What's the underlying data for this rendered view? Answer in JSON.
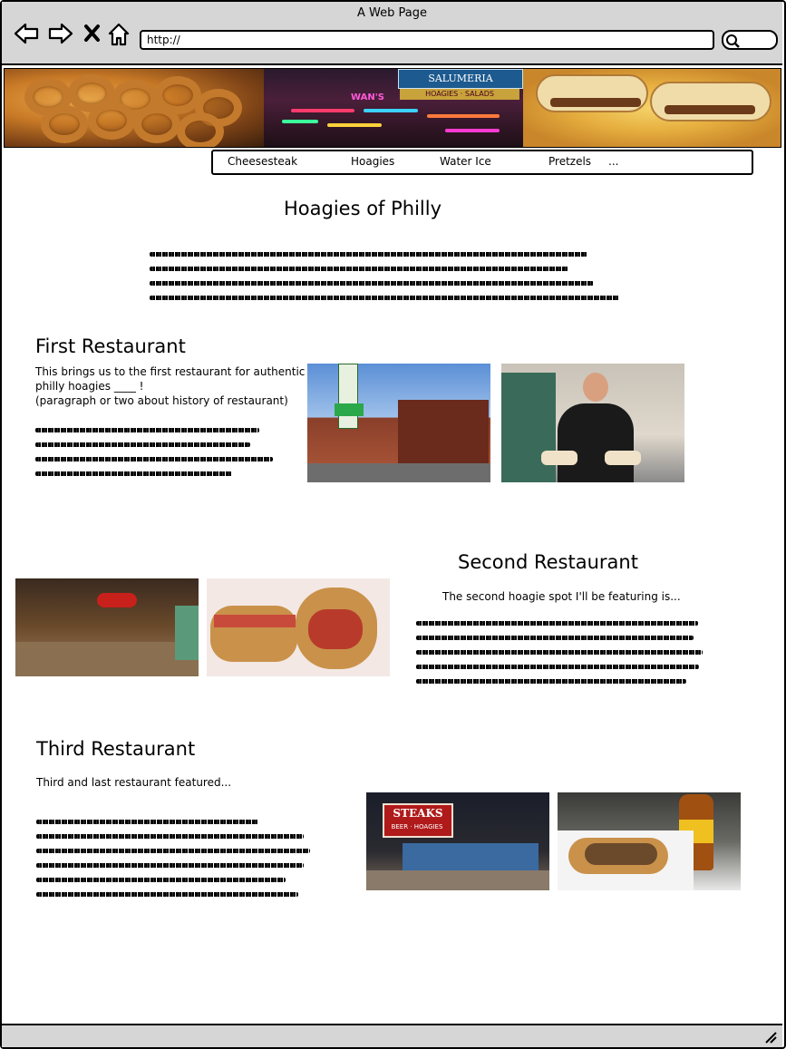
{
  "window": {
    "title": "A Web Page"
  },
  "browser": {
    "url": "http://"
  },
  "nav": {
    "items": [
      "Cheesesteak",
      "Hoagies",
      "Water Ice",
      "Pretzels",
      "..."
    ]
  },
  "page": {
    "title": "Hoagies of Philly"
  },
  "sections": [
    {
      "heading": "First Restaurant",
      "intro_line1": "This brings us to the first restaurant for authentic",
      "intro_line2": "philly hoagies ____ !",
      "intro_line3": "(paragraph or two about history of restaurant)"
    },
    {
      "heading": "Second Restaurant",
      "intro": "The second hoagie spot I'll be featuring is..."
    },
    {
      "heading": "Third Restaurant",
      "intro": "Third and last restaurant featured..."
    }
  ],
  "icons": {
    "back": "arrow-left-icon",
    "forward": "arrow-right-icon",
    "stop": "close-icon",
    "home": "home-icon",
    "search": "search-icon",
    "resize": "resize-grip-icon"
  },
  "banner_text": {
    "deli_sign_1": "SALUMERIA",
    "deli_sign_2": "HOAGIES · SALADS",
    "deli_sign_3": "WAN'S",
    "steaks_sign": "STEAKS",
    "steaks_sub": "BEER · HOAGIES"
  }
}
